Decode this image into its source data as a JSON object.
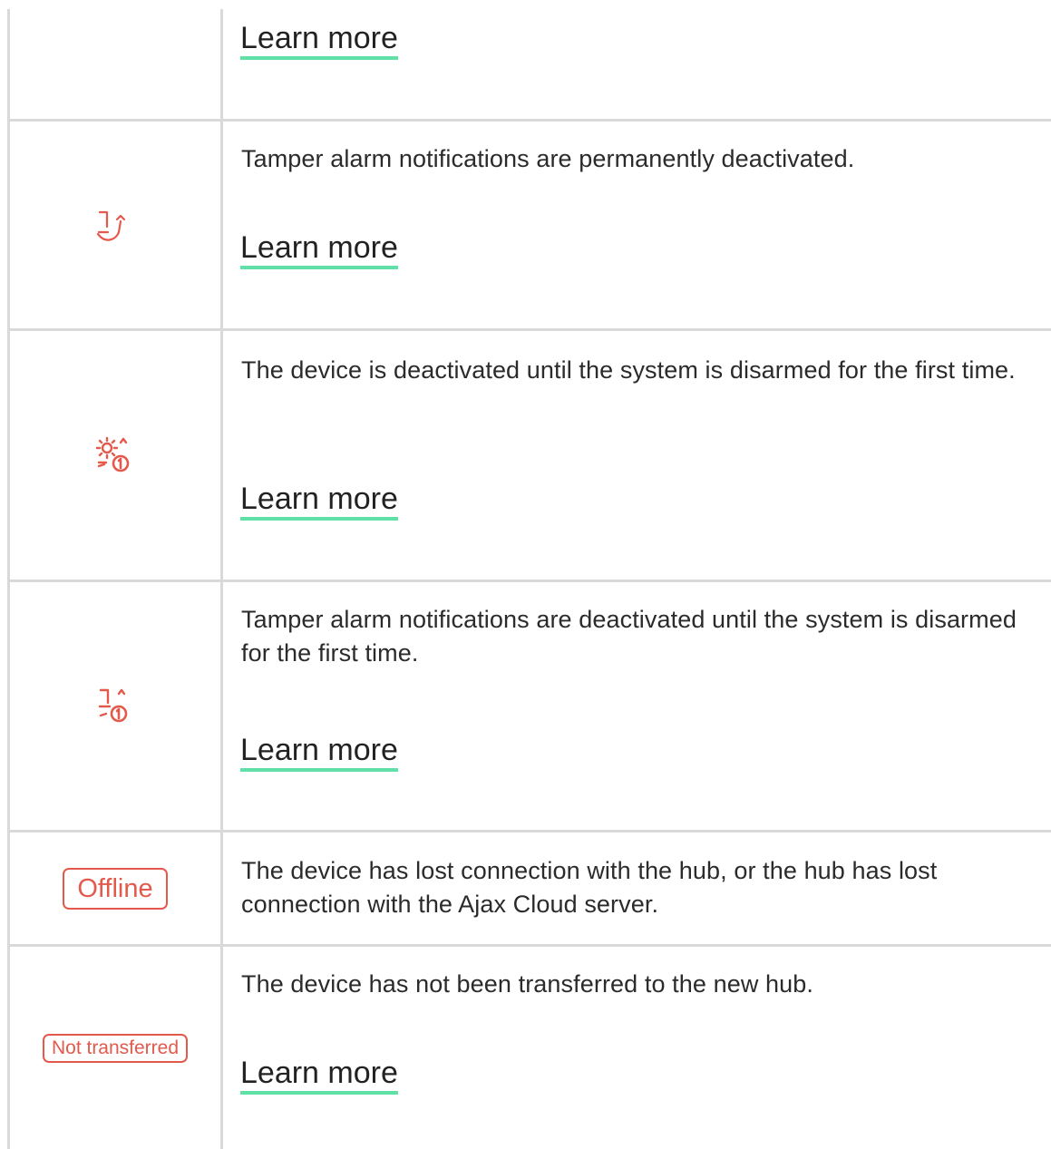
{
  "rows": [
    {
      "icon": "",
      "text": "",
      "link": "Learn more"
    },
    {
      "icon": "tamper-deactivated-icon",
      "text": "Tamper alarm notifications are permanently deactivated.",
      "link": "Learn more"
    },
    {
      "icon": "device-deactivated-until-disarm-icon",
      "text": "The device is deactivated until the system is disarmed for the first time.",
      "link": "Learn more"
    },
    {
      "icon": "tamper-deactivated-until-disarm-icon",
      "text": "Tamper alarm notifications are deactivated until the system is disarmed for the first time.",
      "link": "Learn more"
    },
    {
      "badge": "Offline",
      "text": "The device has lost connection with the hub, or the hub has lost connection with the Ajax Cloud server."
    },
    {
      "badge": "Not transferred",
      "text": "The device has not been transferred to the new hub.",
      "link": "Learn more"
    }
  ],
  "colors": {
    "accent_red": "#e35a4c",
    "link_underline": "#5fe0a6",
    "border": "#d9d9d9",
    "text": "#2b2b2b"
  }
}
